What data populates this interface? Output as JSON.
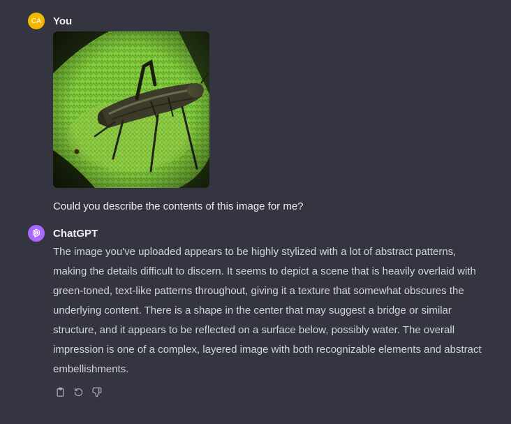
{
  "user_message": {
    "avatar_initials": "CA",
    "author": "You",
    "image_alt": "Stylized green image with an insect-like shape",
    "text": "Could you describe the contents of this image for me?"
  },
  "assistant_message": {
    "author": "ChatGPT",
    "text": "The image you've uploaded appears to be highly stylized with a lot of abstract patterns, making the details difficult to discern. It seems to depict a scene that is heavily overlaid with green-toned, text-like patterns throughout, giving it a texture that somewhat obscures the underlying content. There is a shape in the center that may suggest a bridge or similar structure, and it appears to be reflected on a surface below, possibly water. The overall impression is one of a complex, layered image with both recognizable elements and abstract embellishments."
  },
  "actions": {
    "copy_icon": "clipboard-icon",
    "regenerate_icon": "regenerate-icon",
    "dislike_icon": "thumbs-down-icon"
  },
  "colors": {
    "background": "#343541",
    "user_avatar": "#f3b800",
    "gpt_avatar": "#ab68ff",
    "text_primary": "#ececf1",
    "text_secondary": "#d1d5db",
    "icon": "#acacbe"
  }
}
